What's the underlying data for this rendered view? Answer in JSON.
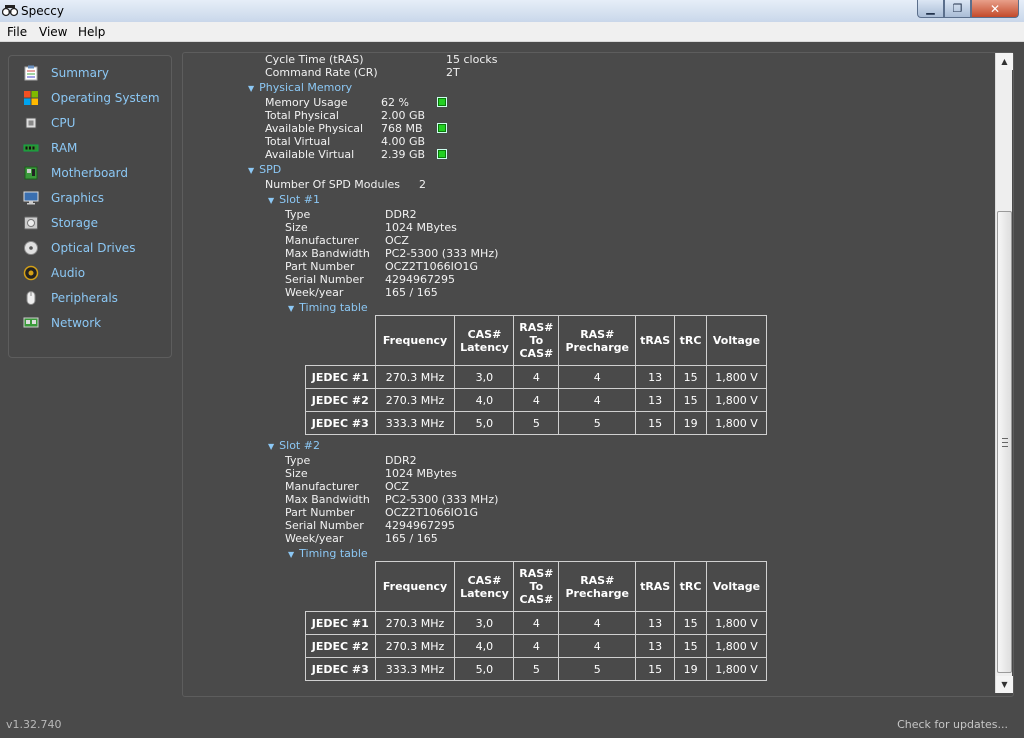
{
  "window": {
    "title": "Speccy",
    "close_symbol": "✕",
    "max_symbol": "❐",
    "min_symbol": "▁"
  },
  "menu": {
    "file": "File",
    "view": "View",
    "help": "Help"
  },
  "sidebar": {
    "items": [
      {
        "label": "Summary",
        "icon": "clipboard-icon"
      },
      {
        "label": "Operating System",
        "icon": "windows-logo-icon"
      },
      {
        "label": "CPU",
        "icon": "cpu-chip-icon"
      },
      {
        "label": "RAM",
        "icon": "ram-module-icon"
      },
      {
        "label": "Motherboard",
        "icon": "motherboard-icon"
      },
      {
        "label": "Graphics",
        "icon": "monitor-icon"
      },
      {
        "label": "Storage",
        "icon": "hard-drive-icon"
      },
      {
        "label": "Optical Drives",
        "icon": "optical-disc-icon"
      },
      {
        "label": "Audio",
        "icon": "speaker-icon"
      },
      {
        "label": "Peripherals",
        "icon": "mouse-icon"
      },
      {
        "label": "Network",
        "icon": "network-icon"
      }
    ]
  },
  "memory": {
    "cycle_time_label": "Cycle Time (tRAS)",
    "cycle_time_value": "15 clocks",
    "command_rate_label": "Command Rate (CR)",
    "command_rate_value": "2T"
  },
  "physical_memory": {
    "heading": "Physical Memory",
    "rows": [
      {
        "label": "Memory Usage",
        "value": "62 %",
        "indicator": true
      },
      {
        "label": "Total Physical",
        "value": "2.00 GB",
        "indicator": false
      },
      {
        "label": "Available Physical",
        "value": "768 MB",
        "indicator": true
      },
      {
        "label": "Total Virtual",
        "value": "4.00 GB",
        "indicator": false
      },
      {
        "label": "Available Virtual",
        "value": "2.39 GB",
        "indicator": true
      }
    ],
    "indicator_color": "#22d022"
  },
  "spd": {
    "heading": "SPD",
    "modules_label": "Number Of SPD Modules",
    "modules_value": "2",
    "timing_heading": "Timing table",
    "table_headers": [
      "Frequency",
      "CAS#\nLatency",
      "RAS#\nTo\nCAS#",
      "RAS#\nPrecharge",
      "tRAS",
      "tRC",
      "Voltage"
    ],
    "slots": [
      {
        "heading": "Slot #1",
        "props": [
          {
            "label": "Type",
            "value": "DDR2"
          },
          {
            "label": "Size",
            "value": "1024 MBytes"
          },
          {
            "label": "Manufacturer",
            "value": "OCZ"
          },
          {
            "label": "Max Bandwidth",
            "value": "PC2-5300 (333 MHz)"
          },
          {
            "label": "Part Number",
            "value": "OCZ2T1066IO1G"
          },
          {
            "label": "Serial Number",
            "value": "4294967295"
          },
          {
            "label": "Week/year",
            "value": "165 / 165"
          }
        ],
        "timings": [
          [
            "JEDEC #1",
            "270.3 MHz",
            "3,0",
            "4",
            "4",
            "13",
            "15",
            "1,800 V"
          ],
          [
            "JEDEC #2",
            "270.3 MHz",
            "4,0",
            "4",
            "4",
            "13",
            "15",
            "1,800 V"
          ],
          [
            "JEDEC #3",
            "333.3 MHz",
            "5,0",
            "5",
            "5",
            "15",
            "19",
            "1,800 V"
          ]
        ]
      },
      {
        "heading": "Slot #2",
        "props": [
          {
            "label": "Type",
            "value": "DDR2"
          },
          {
            "label": "Size",
            "value": "1024 MBytes"
          },
          {
            "label": "Manufacturer",
            "value": "OCZ"
          },
          {
            "label": "Max Bandwidth",
            "value": "PC2-5300 (333 MHz)"
          },
          {
            "label": "Part Number",
            "value": "OCZ2T1066IO1G"
          },
          {
            "label": "Serial Number",
            "value": "4294967295"
          },
          {
            "label": "Week/year",
            "value": "165 / 165"
          }
        ],
        "timings": [
          [
            "JEDEC #1",
            "270.3 MHz",
            "3,0",
            "4",
            "4",
            "13",
            "15",
            "1,800 V"
          ],
          [
            "JEDEC #2",
            "270.3 MHz",
            "4,0",
            "4",
            "4",
            "13",
            "15",
            "1,800 V"
          ],
          [
            "JEDEC #3",
            "333.3 MHz",
            "5,0",
            "5",
            "5",
            "15",
            "19",
            "1,800 V"
          ]
        ]
      }
    ]
  },
  "footer": {
    "version": "v1.32.740",
    "check_updates": "Check for updates..."
  },
  "colors": {
    "background": "#4a4a4a",
    "accent": "#8cc8f5",
    "text": "#f2f2f2"
  }
}
